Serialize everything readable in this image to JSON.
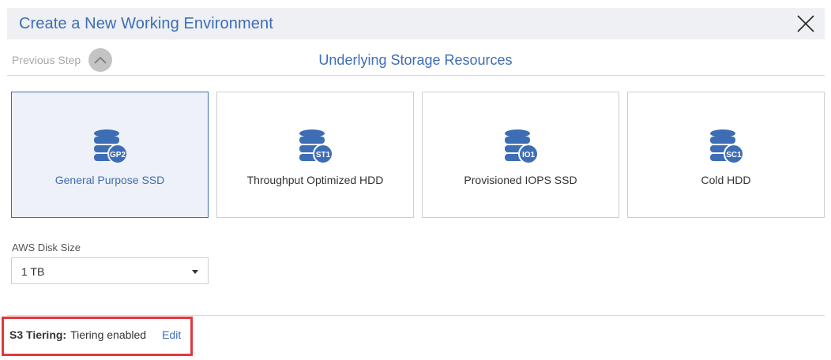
{
  "header": {
    "title": "Create a New Working Environment"
  },
  "nav": {
    "previous_step_label": "Previous Step"
  },
  "section": {
    "title": "Underlying Storage Resources"
  },
  "storage_types": [
    {
      "label": "General Purpose SSD",
      "badge": "GP2",
      "selected": true
    },
    {
      "label": "Throughput Optimized HDD",
      "badge": "ST1",
      "selected": false
    },
    {
      "label": "Provisioned IOPS SSD",
      "badge": "IO1",
      "selected": false
    },
    {
      "label": "Cold HDD",
      "badge": "SC1",
      "selected": false
    }
  ],
  "disk_size": {
    "label": "AWS Disk Size",
    "value": "1 TB"
  },
  "tiering": {
    "key": "S3 Tiering:",
    "value": "Tiering enabled",
    "edit_label": "Edit"
  },
  "colors": {
    "accent": "#3d6db5",
    "highlight": "#e0393e",
    "header_bg": "#eef0f4"
  },
  "icons": {
    "close": "close-icon",
    "previous": "chevron-up-icon",
    "storage": "database-icon"
  }
}
